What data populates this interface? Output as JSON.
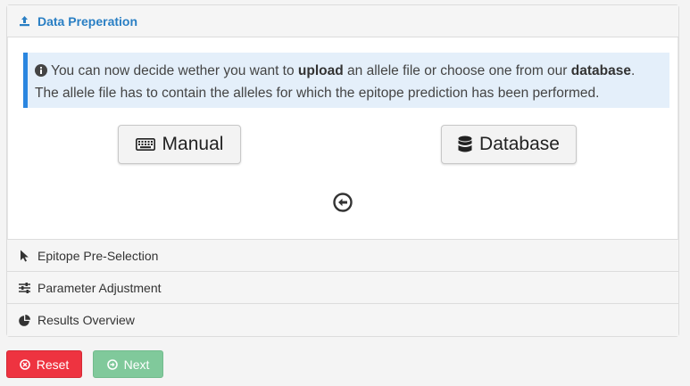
{
  "sections": {
    "active_title": "Data Preperation",
    "epitope": "Epitope Pre-Selection",
    "parameter": "Parameter Adjustment",
    "results": "Results Overview"
  },
  "info": {
    "text1": " You can now decide wether you want to ",
    "bold1": "upload",
    "text2": " an allele file or choose one from our ",
    "bold2": "database",
    "text3": ".",
    "line2": "The allele file has to contain the alleles for which the epitope prediction has been performed."
  },
  "buttons": {
    "manual": "Manual",
    "database": "Database",
    "reset": "Reset",
    "next": "Next"
  },
  "colors": {
    "accent": "#2a7fc4",
    "info_bg": "#e4effa",
    "info_border": "#2a86e0",
    "reset": "#e8363f",
    "next": "#7fc89a"
  },
  "icons": {
    "active": "upload-icon",
    "info": "info-circle-icon",
    "manual": "keyboard-icon",
    "database": "database-icon",
    "back": "arrow-circle-left-icon",
    "epitope": "cursor-icon",
    "parameter": "sliders-icon",
    "results": "pie-chart-icon",
    "reset": "times-circle-icon",
    "next": "arrow-circle-right-icon"
  }
}
